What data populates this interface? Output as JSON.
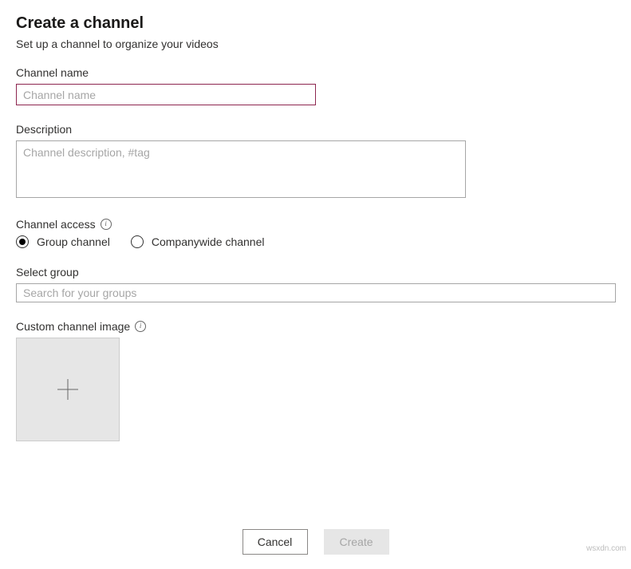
{
  "header": {
    "title": "Create a channel",
    "subtitle": "Set up a channel to organize your videos"
  },
  "fields": {
    "channelName": {
      "label": "Channel name",
      "placeholder": "Channel name",
      "value": ""
    },
    "description": {
      "label": "Description",
      "placeholder": "Channel description, #tag",
      "value": ""
    },
    "channelAccess": {
      "label": "Channel access",
      "options": {
        "group": "Group channel",
        "company": "Companywide channel"
      },
      "selected": "group"
    },
    "selectGroup": {
      "label": "Select group",
      "placeholder": "Search for your groups",
      "value": ""
    },
    "customImage": {
      "label": "Custom channel image"
    }
  },
  "buttons": {
    "cancel": "Cancel",
    "create": "Create"
  },
  "watermark": "wsxdn.com"
}
